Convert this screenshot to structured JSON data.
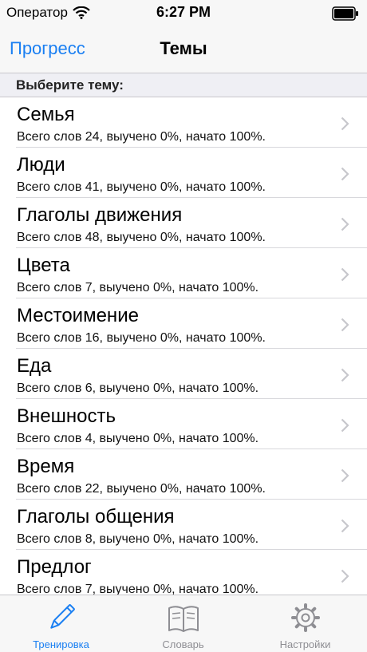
{
  "status_bar": {
    "carrier": "Оператор",
    "time": "6:27 PM"
  },
  "nav": {
    "back_label": "Прогресс",
    "title": "Темы"
  },
  "section_header": "Выберите тему:",
  "topics": [
    {
      "title": "Семья",
      "subtitle": "Всего слов 24, выучено 0%, начато 100%."
    },
    {
      "title": "Люди",
      "subtitle": "Всего слов 41, выучено 0%, начато 100%."
    },
    {
      "title": "Глаголы движения",
      "subtitle": "Всего слов 48, выучено 0%, начато 100%."
    },
    {
      "title": "Цвета",
      "subtitle": "Всего слов 7, выучено 0%, начато 100%."
    },
    {
      "title": "Местоимение",
      "subtitle": "Всего слов 16, выучено 0%, начато 100%."
    },
    {
      "title": "Еда",
      "subtitle": "Всего слов 6, выучено 0%, начато 100%."
    },
    {
      "title": "Внешность",
      "subtitle": "Всего слов 4, выучено 0%, начато 100%."
    },
    {
      "title": "Время",
      "subtitle": "Всего слов 22, выучено 0%, начато 100%."
    },
    {
      "title": "Глаголы общения",
      "subtitle": "Всего слов 8, выучено 0%, начато 100%."
    },
    {
      "title": "Предлог",
      "subtitle": "Всего слов 7, выучено 0%, начато 100%."
    }
  ],
  "tabs": [
    {
      "label": "Тренировка",
      "icon": "pencil-icon",
      "active": true
    },
    {
      "label": "Словарь",
      "icon": "book-icon",
      "active": false
    },
    {
      "label": "Настройки",
      "icon": "gear-icon",
      "active": false
    }
  ],
  "colors": {
    "accent": "#1a7ff2",
    "inactive": "#8e8e93",
    "bar_bg": "#f7f7f7",
    "section_bg": "#efeff4"
  }
}
